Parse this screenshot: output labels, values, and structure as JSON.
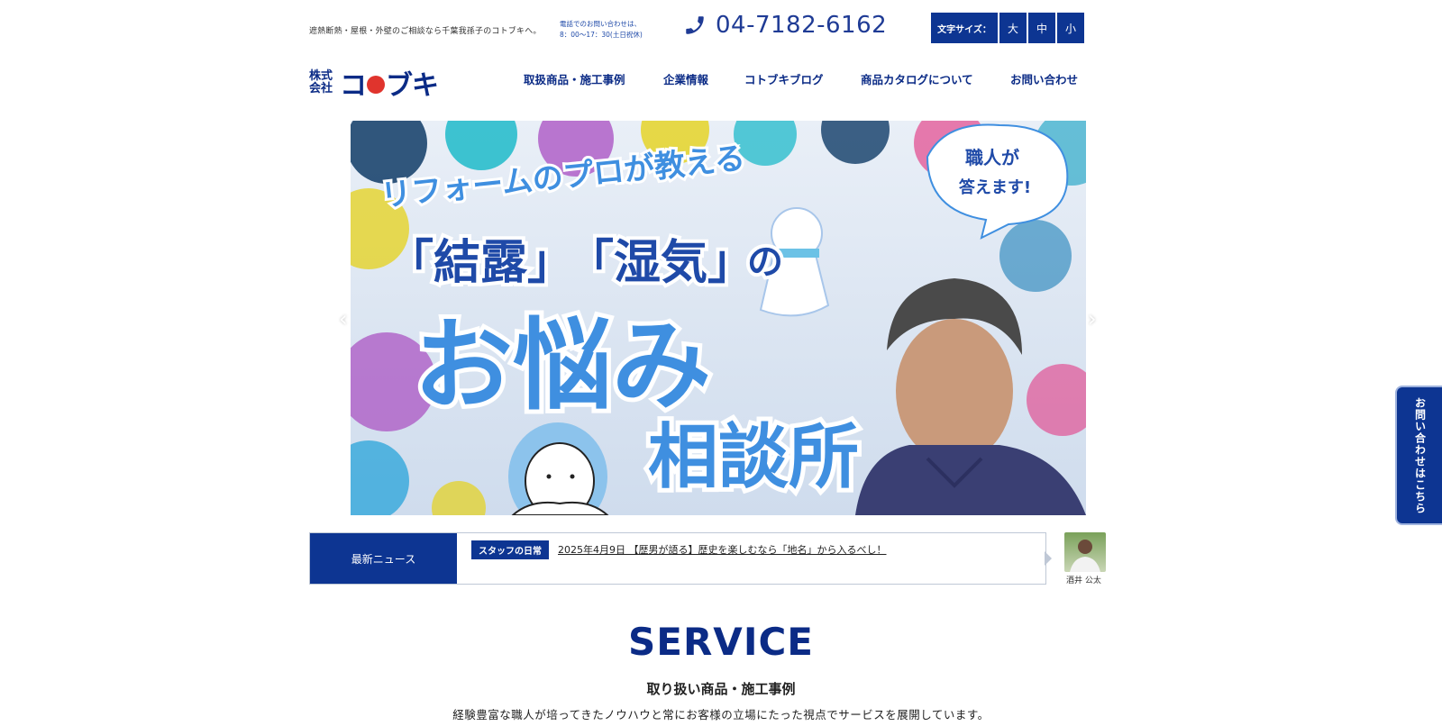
{
  "header": {
    "tagline": "遮熱断熱・屋根・外壁のご相談なら千葉我孫子のコトブキへ。",
    "hours_line1": "電話でのお問い合わせは、",
    "hours_line2": "8：00〜17：30(土日祝休)",
    "phone": "04-7182-6162",
    "font_size_label": "文字サイズ：",
    "font_size_options": [
      "大",
      "中",
      "小"
    ]
  },
  "logo": {
    "prefix_line1": "株式",
    "prefix_line2": "会社",
    "name_part1": "コ",
    "name_part2": "ブキ"
  },
  "nav": {
    "items": [
      "取扱商品・施工事例",
      "企業情報",
      "コトブキブログ",
      "商品カタログについて",
      "お問い合わせ"
    ]
  },
  "hero": {
    "line1": "リフォームのプロが教える",
    "line2a": "「結露」",
    "line2b": "「湿気」",
    "line2c": "の",
    "line3": "お悩み",
    "line4": "相談所",
    "bubble_line1": "職人が",
    "bubble_line2": "答えます!"
  },
  "news": {
    "label": "最新ニュース",
    "category": "スタッフの日常",
    "title": "2025年4月9日 【歴男が語る】歴史を楽しむなら「地名」から入るべし！",
    "author": "酒井 公太"
  },
  "side_tab": {
    "label": "お問い合わせはこちら"
  },
  "service": {
    "title": "SERVICE",
    "subtitle": "取り扱い商品・施工事例",
    "description": "経験豊富な職人が培ってきたノウハウと常にお客様の立場にたった視点でサービスを展開しています。"
  },
  "colors": {
    "brand_navy": "#0d3592",
    "accent_red": "#e0342d",
    "highlight_pink": "#f3b3b3",
    "hero_blue": "#3f8fe0"
  },
  "icons": {
    "phone": "phone-icon",
    "prev": "chevron-left-icon",
    "next": "chevron-right-icon"
  }
}
